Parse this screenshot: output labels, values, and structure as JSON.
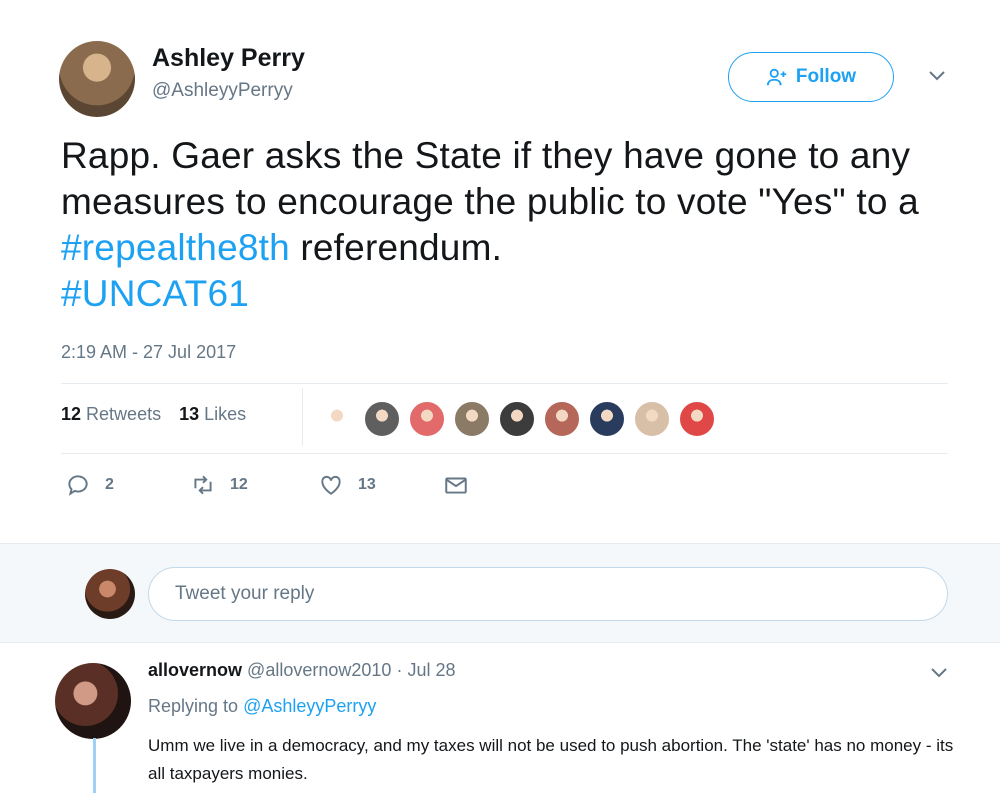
{
  "tweet": {
    "author_name": "Ashley Perry",
    "author_handle": "@AshleyyPerryy",
    "follow_label": "Follow",
    "text_part1": "Rapp. Gaer asks the State if they have gone to any measures to encourage the public to vote \"Yes\" to a ",
    "hashtag1": "#repealthe8th",
    "text_part2": " referendum.",
    "hashtag2": "#UNCAT61",
    "timestamp": "2:19 AM - 27 Jul 2017",
    "retweets_count": "12",
    "retweets_label": "Retweets",
    "likes_count": "13",
    "likes_label": "Likes",
    "reply_count": "2",
    "retweet_action_count": "12",
    "like_action_count": "13"
  },
  "likers": [
    {
      "icon": "repeal-logo-avatar",
      "color": "#ffffff"
    },
    {
      "icon": "person-avatar",
      "color": "#5f5f5f"
    },
    {
      "icon": "badge-avatar",
      "color": "#e36a6a"
    },
    {
      "icon": "person-avatar",
      "color": "#8a7a66"
    },
    {
      "icon": "person-avatar",
      "color": "#3c3c3c"
    },
    {
      "icon": "person-avatar",
      "color": "#b5675a"
    },
    {
      "icon": "person-avatar",
      "color": "#2a3c5e"
    },
    {
      "icon": "person-avatar",
      "color": "#d8c0a8"
    },
    {
      "icon": "badge-avatar",
      "color": "#e04848"
    }
  ],
  "reply_box": {
    "placeholder": "Tweet your reply"
  },
  "reply": {
    "author_name": "allovernow",
    "author_handle": "@allovernow2010",
    "date": "Jul 28",
    "replying_prefix": "Replying to",
    "replying_handle": "@AshleyyPerryy",
    "text": "Umm we live in a democracy, and my taxes will not be used to push abortion. The 'state' has no money - its all taxpayers monies."
  },
  "colors": {
    "accent": "#1da1f2",
    "muted": "#657786",
    "text": "#14171a"
  }
}
